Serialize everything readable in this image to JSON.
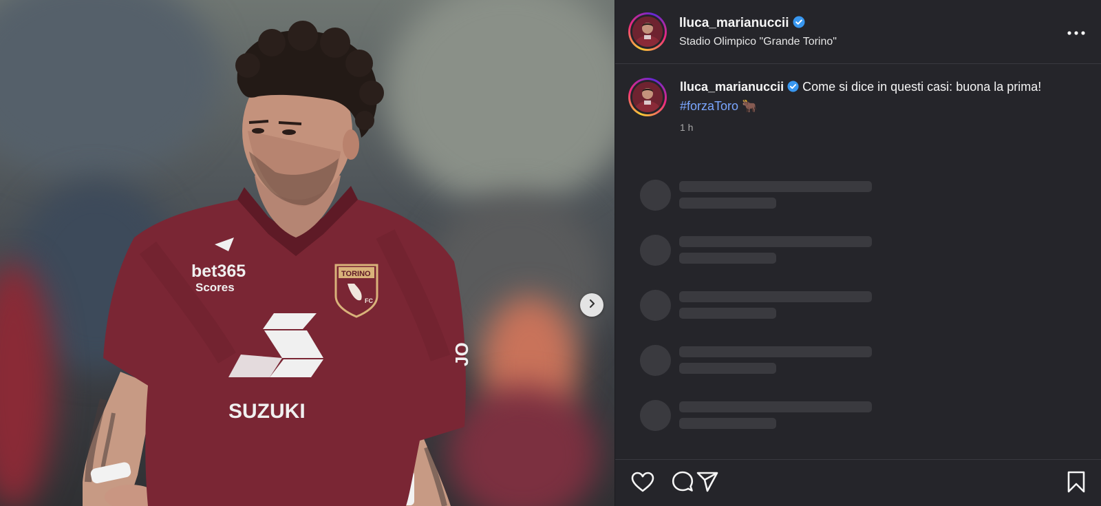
{
  "post": {
    "username": "lluca_marianuccii",
    "verified": true,
    "location": "Stadio Olimpico \"Grande Torino\"",
    "caption_text": " Come si dice in questi casi: buona la prima! ",
    "hashtag": "#forzaToro",
    "emoji": "🐂",
    "time": "1 h"
  },
  "photo": {
    "sponsor_chest": "bet365",
    "sponsor_chest_sub": "Scores",
    "sponsor_main": "SUZUKI",
    "crest_text": "TORINO",
    "crest_fc": "FC",
    "sleeve_text": "JO"
  },
  "skeleton_rows": 5,
  "colors": {
    "panel_bg": "#25252a",
    "link": "#7aa6ff",
    "verified": "#3897f0",
    "jersey": "#7a2634"
  },
  "icons": [
    "verified-badge-icon",
    "more-options-icon",
    "chevron-right-icon",
    "heart-icon",
    "comment-icon",
    "share-icon",
    "bookmark-icon"
  ]
}
